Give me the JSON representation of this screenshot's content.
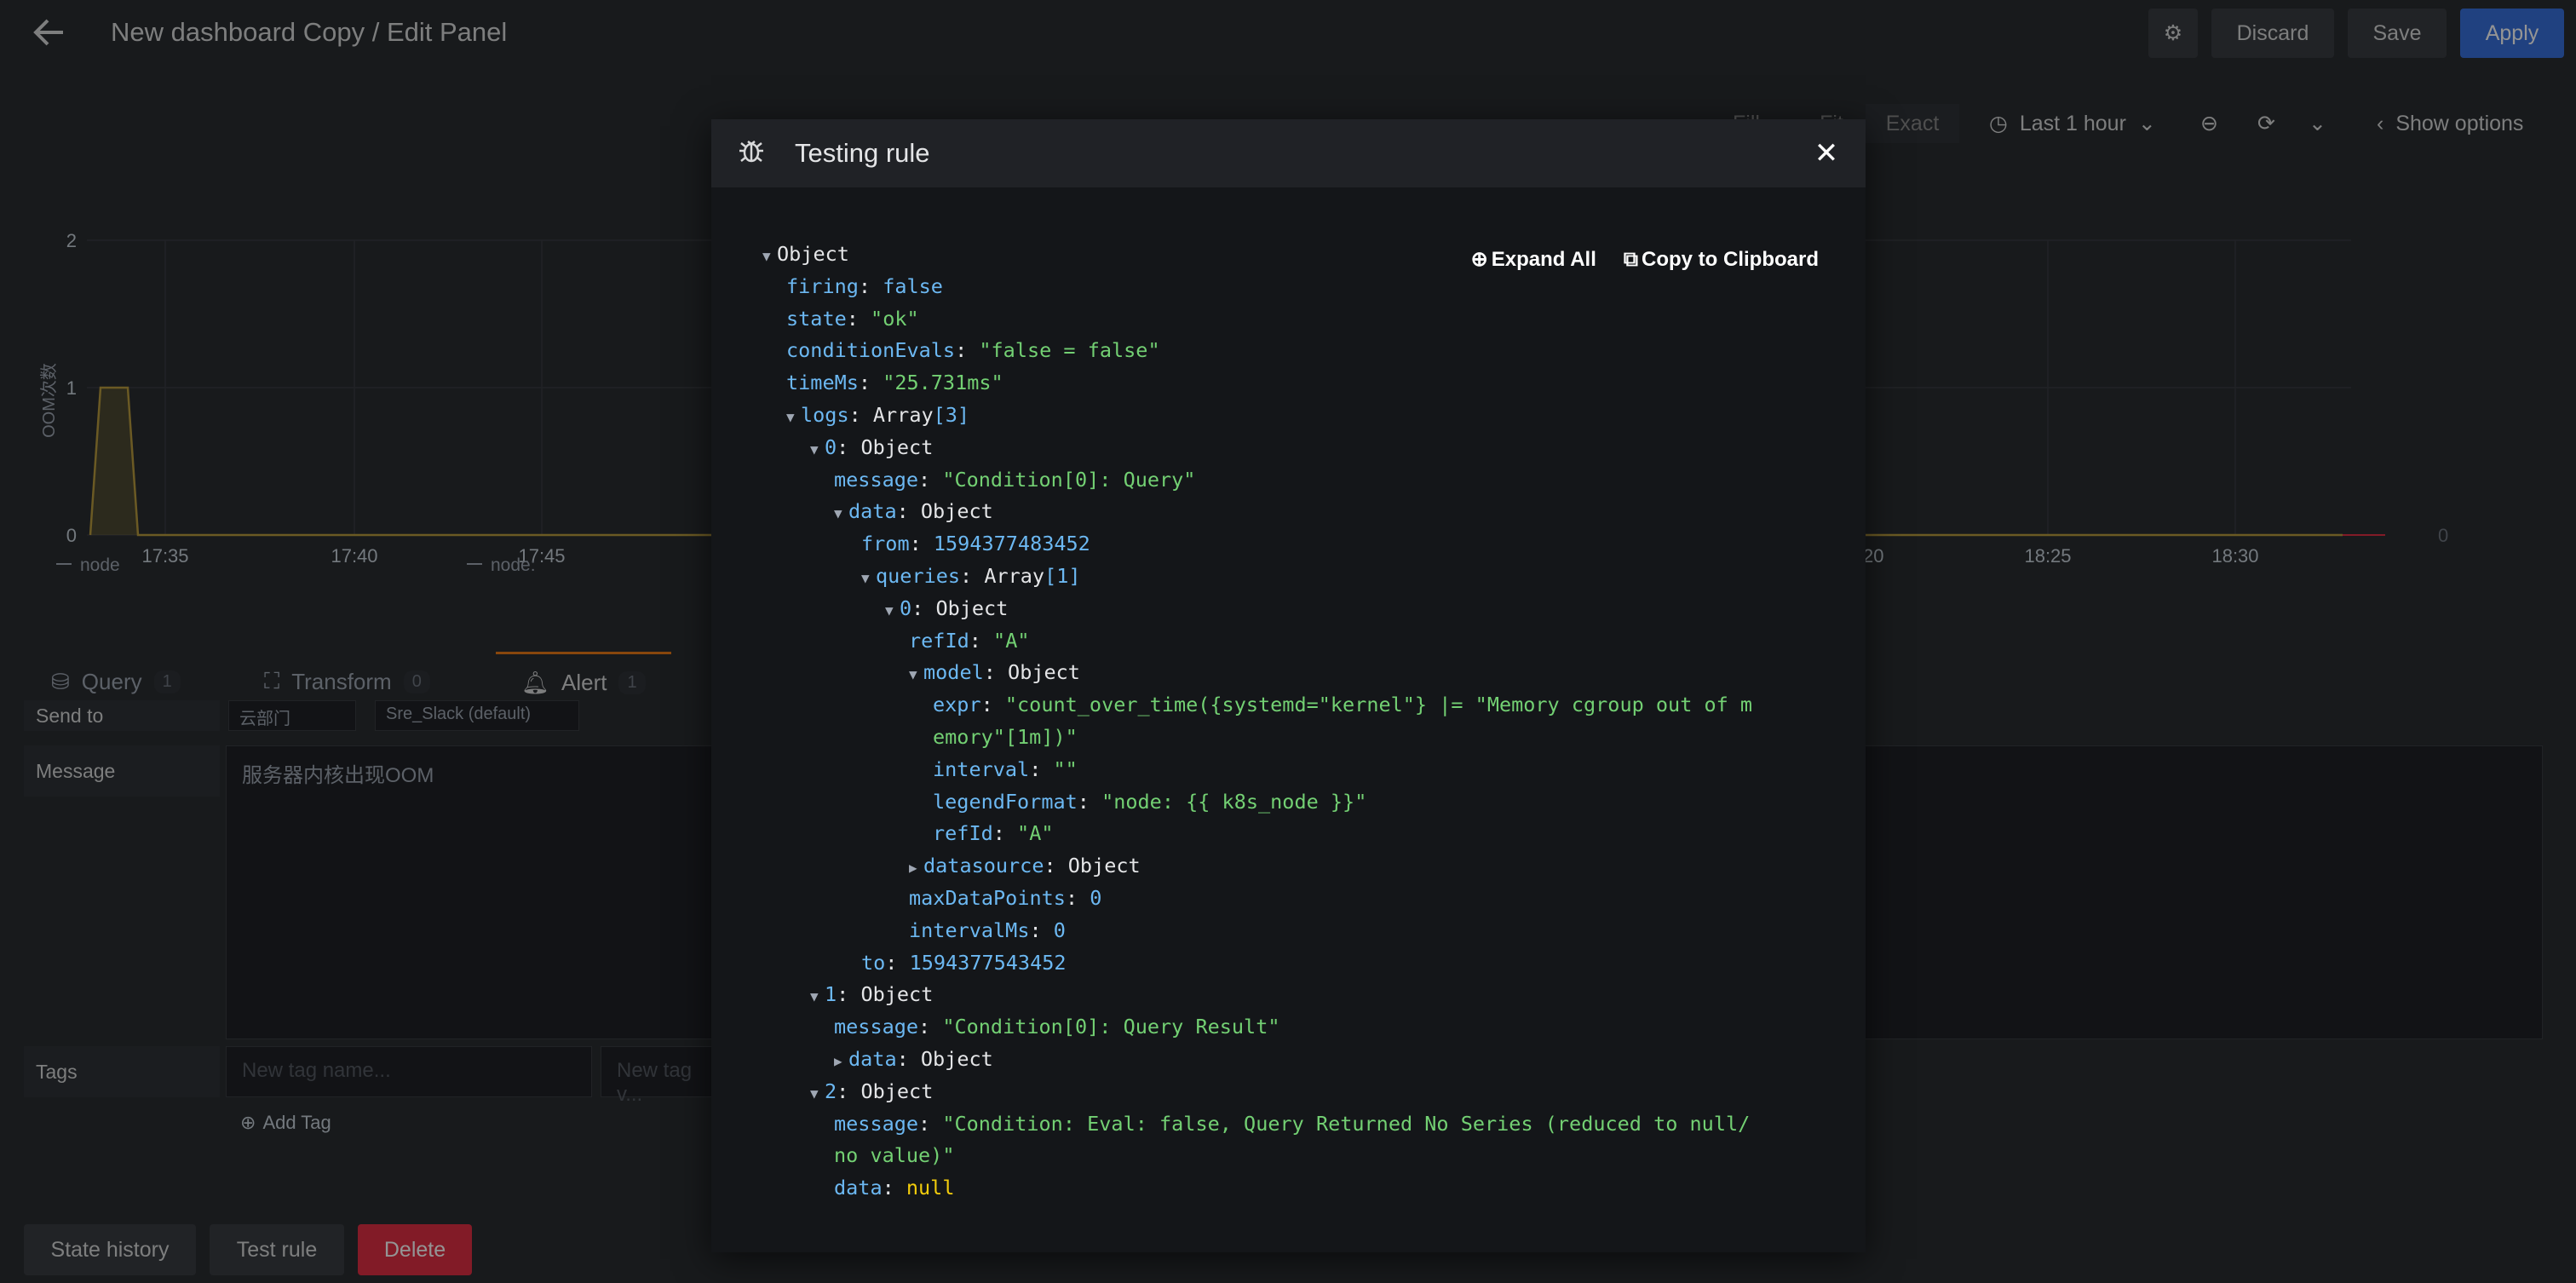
{
  "header": {
    "title": "New dashboard Copy / Edit Panel",
    "discard": "Discard",
    "save": "Save",
    "apply": "Apply"
  },
  "timebar": {
    "fill": "Fill",
    "fit": "Fit",
    "exact": "Exact",
    "range": "Last 1 hour",
    "show_options": "Show options"
  },
  "chart_data": {
    "type": "line",
    "ylabel": "OOM次数",
    "yticks": [
      "0",
      "1",
      "2"
    ],
    "xticks": [
      "17:35",
      "17:40",
      "17:45",
      "18:20",
      "18:25",
      "18:30"
    ],
    "ylim": [
      0,
      2
    ],
    "legend": [
      "node",
      "node:"
    ],
    "threshold_value": "0"
  },
  "panel_tabs": [
    {
      "label": "Query",
      "count": "1"
    },
    {
      "label": "Transform",
      "count": "0"
    },
    {
      "label": "Alert",
      "count": "1"
    }
  ],
  "alert_form": {
    "send_to_label": "Send to",
    "send_to_value_1": "云部门",
    "send_to_value_2": "Sre_Slack (default)",
    "message_label": "Message",
    "message_value": "服务器内核出现OOM",
    "tags_label": "Tags",
    "tag_name_placeholder": "New tag name...",
    "tag_value_placeholder": "New tag v...",
    "add_tag": "Add Tag"
  },
  "bottom_buttons": {
    "state_history": "State history",
    "test_rule": "Test rule",
    "delete": "Delete"
  },
  "modal": {
    "title": "Testing rule",
    "expand_all": "Expand All",
    "copy_clipboard": "Copy to Clipboard",
    "tree": {
      "root": "Object",
      "firing": "false",
      "state": "\"ok\"",
      "conditionEvals": "\"false = false\"",
      "timeMs": "\"25.731ms\"",
      "logs_type": "Array",
      "logs_len": "[3]",
      "log0_message": "\"Condition[0]: Query\"",
      "from": "1594377483452",
      "queries_len": "[1]",
      "refId_outer": "\"A\"",
      "expr_line1": "\"count_over_time({systemd=\"kernel\"} |= \"Memory cgroup out of m",
      "expr_line2": "emory\"[1m])\"",
      "interval": "\"\"",
      "legendFormat": "\"node: {{ k8s_node }}\"",
      "refId_inner": "\"A\"",
      "maxDataPoints": "0",
      "intervalMs": "0",
      "to": "1594377543452",
      "log1_message": "\"Condition[0]: Query Result\"",
      "log2_message_line1": "\"Condition: Eval: false, Query Returned No Series (reduced to null/",
      "log2_message_line2": "no value)\"",
      "log2_data": "null"
    }
  }
}
